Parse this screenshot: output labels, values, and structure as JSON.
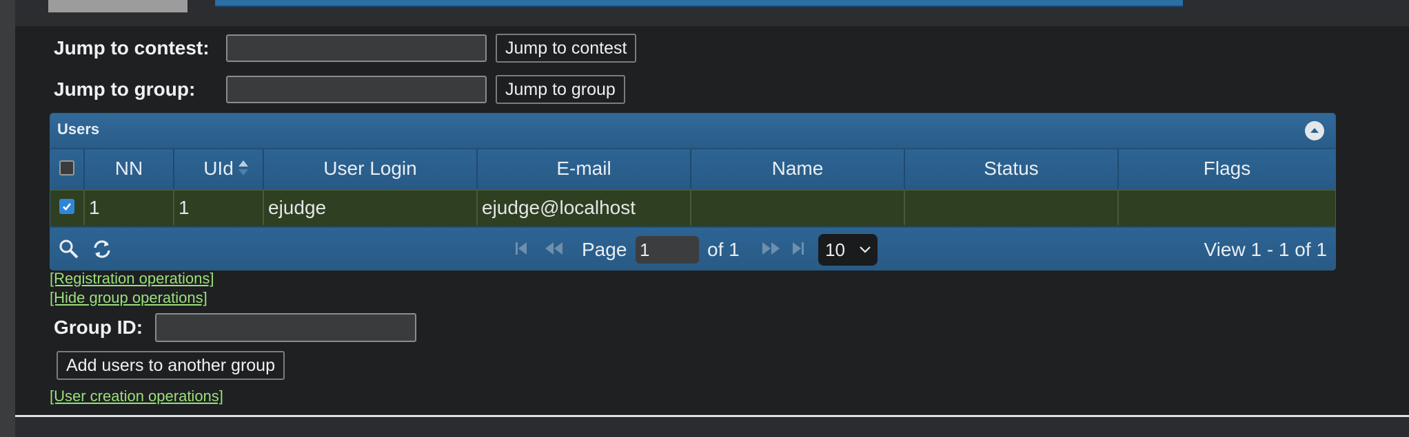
{
  "jump_contest": {
    "label": "Jump to contest:",
    "value": "",
    "button": "Jump to contest"
  },
  "jump_group": {
    "label": "Jump to group:",
    "value": "",
    "button": "Jump to group"
  },
  "users_grid": {
    "title": "Users",
    "columns": [
      "NN",
      "UId",
      "User Login",
      "E-mail",
      "Name",
      "Status",
      "Flags"
    ],
    "rows": [
      {
        "selected": true,
        "nn": "1",
        "uid": "1",
        "login": "ejudge",
        "email": "ejudge@localhost",
        "name": "",
        "status": "",
        "flags": ""
      }
    ],
    "pager": {
      "page_label": "Page",
      "page_value": "1",
      "of_label": "of 1",
      "rows_per_page": "10",
      "view_label": "View 1 - 1 of 1"
    }
  },
  "links": {
    "registration": "[Registration operations]",
    "hide_group": "[Hide group operations]",
    "user_creation": "[User creation operations]"
  },
  "group_ops": {
    "label": "Group ID:",
    "value": "",
    "button": "Add users to another group"
  },
  "icons": [
    "search-icon",
    "refresh-icon",
    "first-page-icon",
    "prev-page-icon",
    "next-page-icon",
    "last-page-icon",
    "chevron-down-icon",
    "chevron-up-icon",
    "sort-icon"
  ],
  "colors": {
    "header_blue": "#2c5f8c",
    "row_selected": "#2e3f22",
    "link_green": "#9be07b",
    "background": "#1e2022"
  }
}
